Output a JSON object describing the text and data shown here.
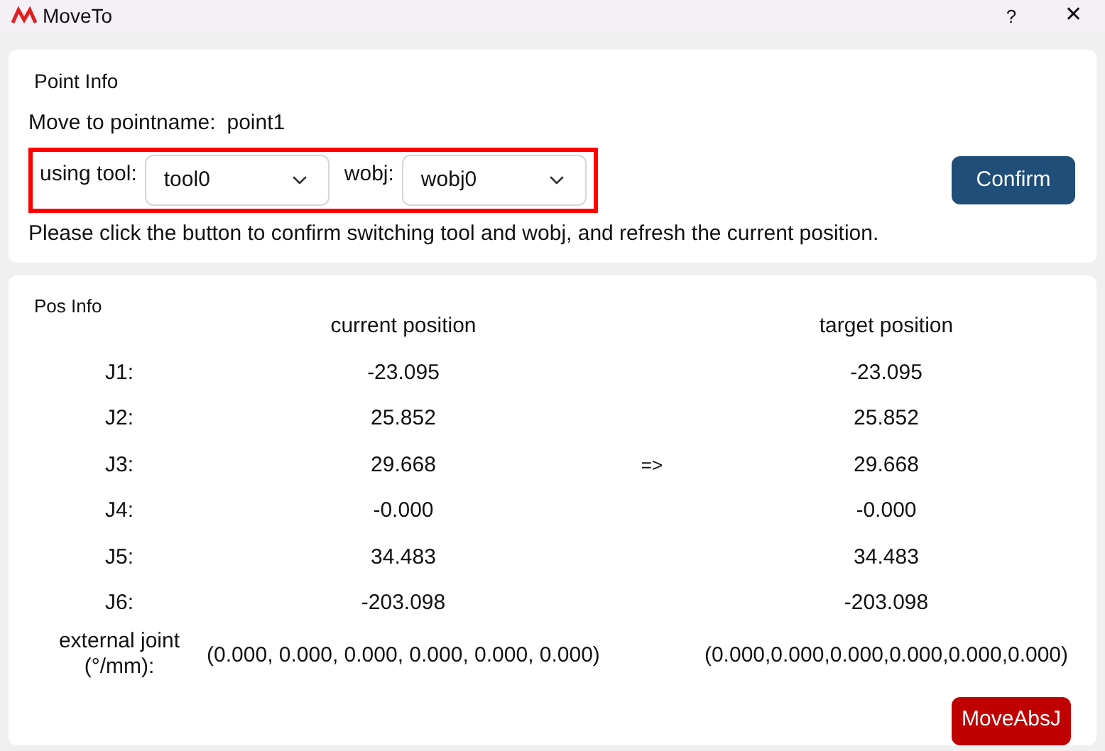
{
  "window": {
    "title": "MoveTo",
    "help": "?",
    "close": "✕"
  },
  "point_info": {
    "title": "Point Info",
    "pointname_label": "Move to pointname:",
    "pointname": "point1",
    "tool_label": "using tool:",
    "tool": "tool0",
    "wobj_label": "wobj:",
    "wobj": "wobj0",
    "confirm": "Confirm",
    "hint": "Please click the button to confirm switching tool and wobj, and refresh the current position.",
    "highlighted": true
  },
  "pos_info": {
    "title": "Pos Info",
    "current_heading": "current position",
    "target_heading": "target position",
    "arrow": "=>",
    "rows": [
      {
        "label": "J1:",
        "current": "-23.095",
        "target": "-23.095"
      },
      {
        "label": "J2:",
        "current": "25.852",
        "target": "25.852"
      },
      {
        "label": "J3:",
        "current": "29.668",
        "target": "29.668"
      },
      {
        "label": "J4:",
        "current": "-0.000",
        "target": "-0.000"
      },
      {
        "label": "J5:",
        "current": "34.483",
        "target": "34.483"
      },
      {
        "label": "J6:",
        "current": "-203.098",
        "target": "-203.098"
      },
      {
        "label": "external joint (°/mm):",
        "current": "(0.000, 0.000, 0.000, 0.000, 0.000, 0.000)",
        "target": "(0.000,0.000,0.000,0.000,0.000,0.000)"
      }
    ],
    "move_button": "MoveAbsJ"
  }
}
